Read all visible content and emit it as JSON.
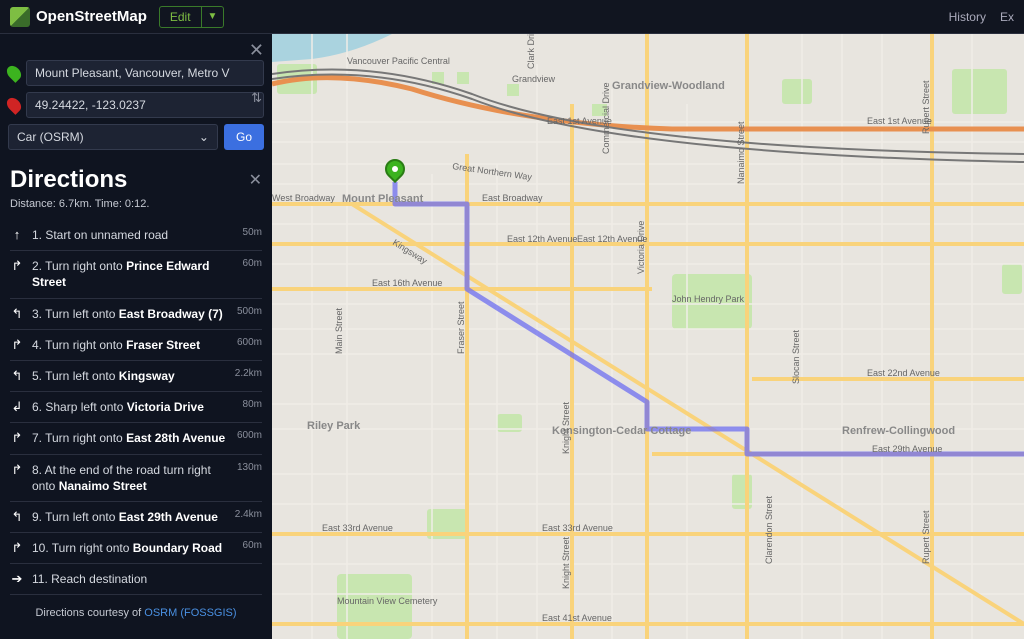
{
  "header": {
    "brand": "OpenStreetMap",
    "edit_label": "Edit",
    "nav": {
      "history": "History",
      "export": "Ex"
    }
  },
  "route_form": {
    "from_value": "Mount Pleasant, Vancouver, Metro V",
    "to_value": "49.24422, -123.0237",
    "mode_label": "Car (OSRM)",
    "go_label": "Go"
  },
  "directions": {
    "title": "Directions",
    "summary": "Distance: 6.7km. Time: 0:12.",
    "steps": [
      {
        "icon": "↑",
        "num": "1.",
        "pre": "Start on unnamed road",
        "bold": "",
        "post": "",
        "dist": "50m"
      },
      {
        "icon": "↱",
        "num": "2.",
        "pre": "Turn right onto ",
        "bold": "Prince Edward Street",
        "post": "",
        "dist": "60m"
      },
      {
        "icon": "↰",
        "num": "3.",
        "pre": "Turn left onto ",
        "bold": "East Broadway (7)",
        "post": "",
        "dist": "500m"
      },
      {
        "icon": "↱",
        "num": "4.",
        "pre": "Turn right onto ",
        "bold": "Fraser Street",
        "post": "",
        "dist": "600m"
      },
      {
        "icon": "↰",
        "num": "5.",
        "pre": "Turn left onto ",
        "bold": "Kingsway",
        "post": "",
        "dist": "2.2km"
      },
      {
        "icon": "↲",
        "num": "6.",
        "pre": "Sharp left onto ",
        "bold": "Victoria Drive",
        "post": "",
        "dist": "80m"
      },
      {
        "icon": "↱",
        "num": "7.",
        "pre": "Turn right onto ",
        "bold": "East 28th Avenue",
        "post": "",
        "dist": "600m"
      },
      {
        "icon": "↱",
        "num": "8.",
        "pre": "At the end of the road turn right onto ",
        "bold": "Nanaimo Street",
        "post": "",
        "dist": "130m"
      },
      {
        "icon": "↰",
        "num": "9.",
        "pre": "Turn left onto ",
        "bold": "East 29th Avenue",
        "post": "",
        "dist": "2.4km"
      },
      {
        "icon": "↱",
        "num": "10.",
        "pre": "Turn right onto ",
        "bold": "Boundary Road",
        "post": "",
        "dist": "60m"
      },
      {
        "icon": "➔",
        "num": "11.",
        "pre": "Reach destination",
        "bold": "",
        "post": "",
        "dist": ""
      }
    ],
    "credit_pre": "Directions courtesy of ",
    "credit_link": "OSRM (FOSSGIS)"
  },
  "map": {
    "areas": {
      "mount_pleasant": "Mount Pleasant",
      "grandview_woodland": "Grandview-Woodland",
      "riley_park": "Riley Park",
      "kensington": "Kensington-Cedar Cottage",
      "renfrew": "Renfrew-Collingwood",
      "john_hendry": "John Hendry Park",
      "mtn_view": "Mountain View Cemetery",
      "vancouver_pacific": "Vancouver Pacific Central"
    },
    "streets": {
      "west_broadway": "West Broadway",
      "east_broadway": "East Broadway",
      "e12": "East 12th Avenue",
      "e12b": "East 12th Avenue",
      "e16": "East 16th Avenue",
      "e1st": "East 1st Avenue",
      "e1stb": "East 1st Avenue",
      "e22": "East 22nd Avenue",
      "e29": "East 29th Avenue",
      "e33": "East 33rd Avenue",
      "e33b": "East 33rd Avenue",
      "e41": "East 41st Avenue",
      "kingsway": "Kingsway",
      "grandview": "Grandview",
      "great_northern": "Great Northern Way",
      "main": "Main Street",
      "fraser": "Fraser Street",
      "knight": "Knight Street",
      "knightb": "Knight Street",
      "clark": "Clark Drive",
      "commercial": "Commercial Drive",
      "victoria": "Victoria Drive",
      "nanaimo": "Nanaimo Street",
      "slocan": "Slocan Street",
      "rupert": "Rupert Street",
      "rupertb": "Rupert Street",
      "clarendon": "Clarendon Street"
    },
    "route_coords": {
      "from": "Mount Pleasant",
      "to": "49.24422, -123.0237"
    }
  }
}
